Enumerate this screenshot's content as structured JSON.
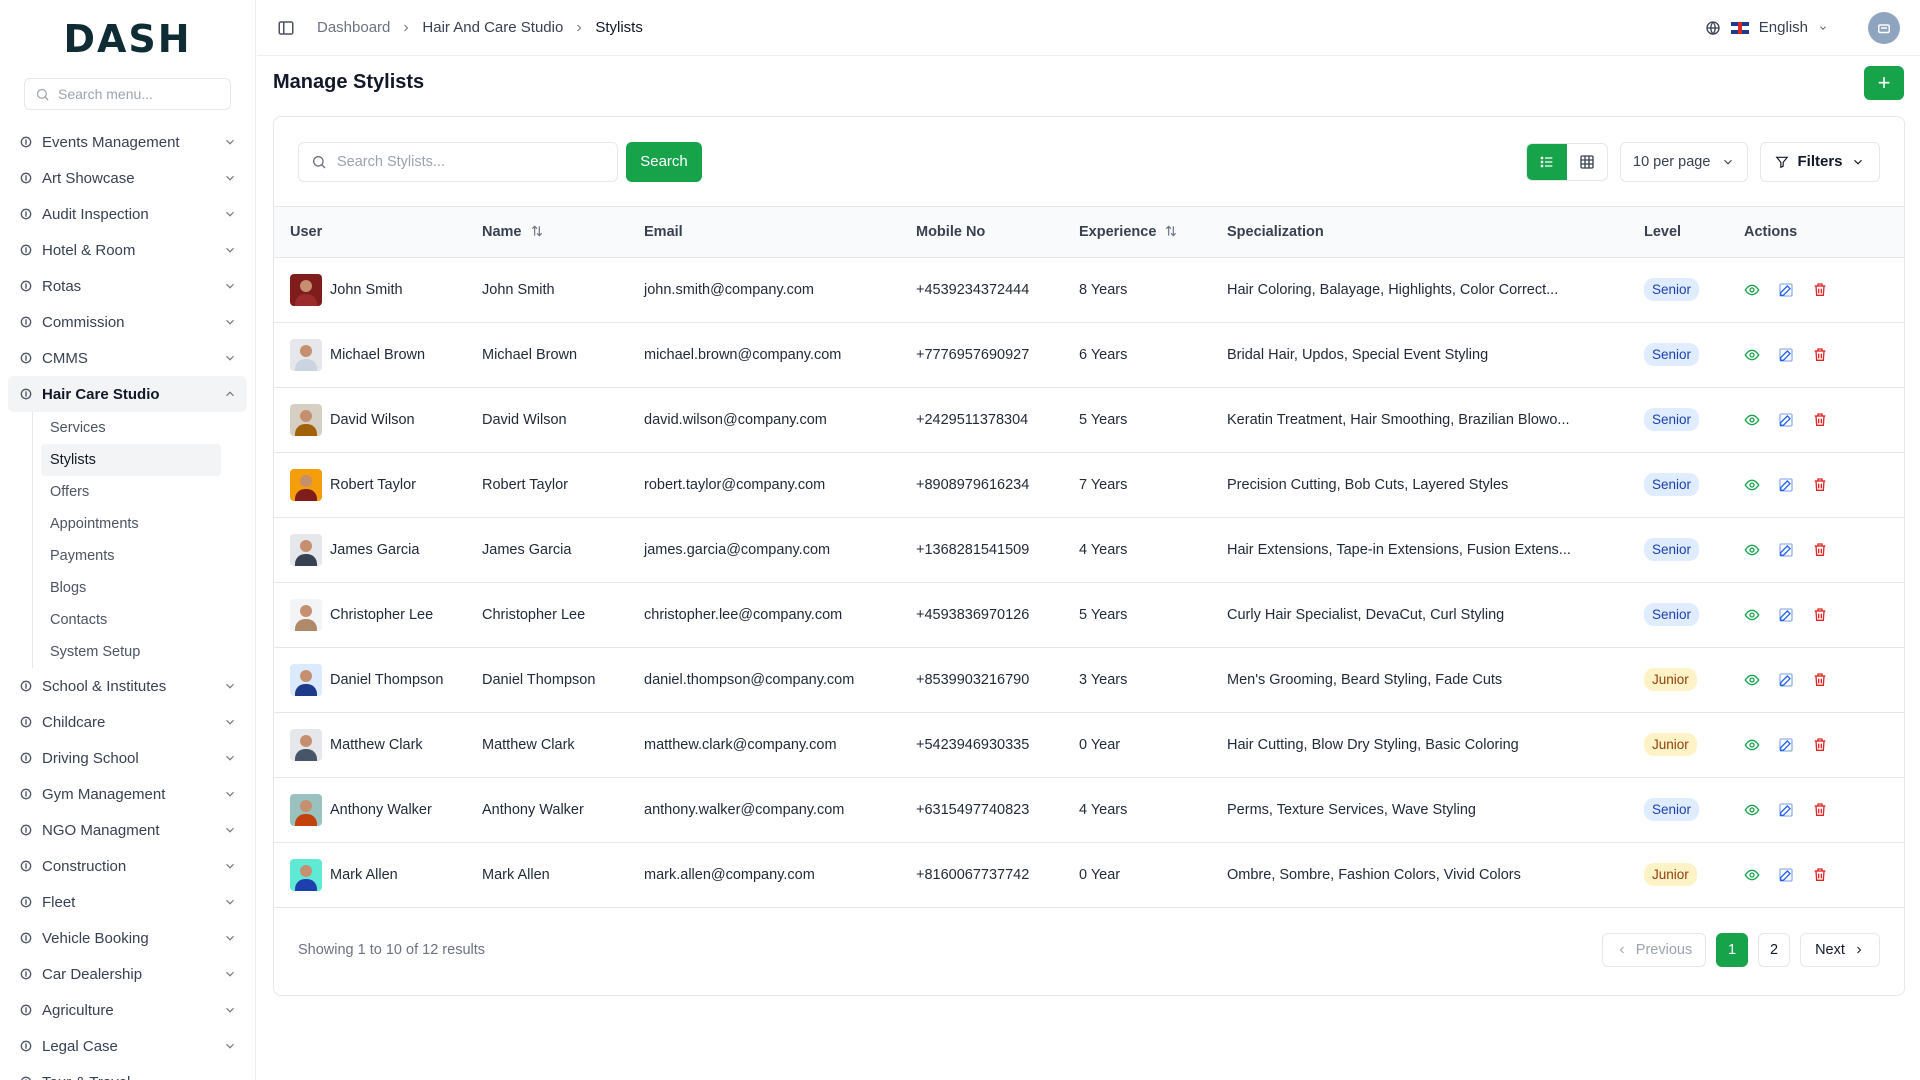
{
  "app": {
    "logo": "DASH"
  },
  "sidebar": {
    "search_placeholder": "Search menu...",
    "items": [
      {
        "label": "Events Management",
        "icon": "events-icon"
      },
      {
        "label": "Art Showcase",
        "icon": "palette-icon"
      },
      {
        "label": "Audit Inspection",
        "icon": "audit-icon"
      },
      {
        "label": "Hotel & Room",
        "icon": "hotel-icon"
      },
      {
        "label": "Rotas",
        "icon": "calendar-icon"
      },
      {
        "label": "Commission",
        "icon": "trend-icon"
      },
      {
        "label": "CMMS",
        "icon": "cog-icon"
      },
      {
        "label": "Hair Care Studio",
        "icon": "scissors-icon"
      }
    ],
    "sub_items": [
      "Services",
      "Stylists",
      "Offers",
      "Appointments",
      "Payments",
      "Blogs",
      "Contacts",
      "System Setup"
    ],
    "items_after": [
      {
        "label": "School & Institutes",
        "icon": "school-icon"
      },
      {
        "label": "Childcare",
        "icon": "childcare-icon"
      },
      {
        "label": "Driving School",
        "icon": "steering-icon"
      },
      {
        "label": "Gym Management",
        "icon": "dumbbell-icon"
      },
      {
        "label": "NGO Managment",
        "icon": "handshake-icon"
      },
      {
        "label": "Construction",
        "icon": "construction-icon"
      },
      {
        "label": "Fleet",
        "icon": "fleet-icon"
      },
      {
        "label": "Vehicle Booking",
        "icon": "car-icon"
      },
      {
        "label": "Car Dealership",
        "icon": "car-dealer-icon"
      },
      {
        "label": "Agriculture",
        "icon": "agriculture-icon"
      },
      {
        "label": "Legal Case",
        "icon": "scale-icon"
      },
      {
        "label": "Tour & Travel",
        "icon": "travel-icon"
      }
    ]
  },
  "header": {
    "breadcrumb": [
      "Dashboard",
      "Hair And Care Studio",
      "Stylists"
    ],
    "language": "English"
  },
  "page": {
    "title": "Manage Stylists",
    "add_label": "+"
  },
  "toolbar": {
    "search_placeholder": "Search Stylists...",
    "search_button": "Search",
    "per_page": "10 per page",
    "filters": "Filters"
  },
  "table": {
    "columns": [
      "User",
      "Name",
      "Email",
      "Mobile No",
      "Experience",
      "Specialization",
      "Level",
      "Actions"
    ],
    "rows": [
      {
        "user": "John Smith",
        "name": "John Smith",
        "email": "john.smith@company.com",
        "mobile": "+4539234372444",
        "experience": "8 Years",
        "specialization": "Hair Coloring, Balayage, Highlights, Color Correct...",
        "level": "Senior",
        "avatar_bg": "#7f1d1d",
        "avatar_shirt": "#9b2c2c"
      },
      {
        "user": "Michael Brown",
        "name": "Michael Brown",
        "email": "michael.brown@company.com",
        "mobile": "+7776957690927",
        "experience": "6 Years",
        "specialization": "Bridal Hair, Updos, Special Event Styling",
        "level": "Senior",
        "avatar_bg": "#e5e7eb",
        "avatar_shirt": "#cbd5e1"
      },
      {
        "user": "David Wilson",
        "name": "David Wilson",
        "email": "david.wilson@company.com",
        "mobile": "+2429511378304",
        "experience": "5 Years",
        "specialization": "Keratin Treatment, Hair Smoothing, Brazilian Blowo...",
        "level": "Senior",
        "avatar_bg": "#d6cfc4",
        "avatar_shirt": "#a16207"
      },
      {
        "user": "Robert Taylor",
        "name": "Robert Taylor",
        "email": "robert.taylor@company.com",
        "mobile": "+8908979616234",
        "experience": "7 Years",
        "specialization": "Precision Cutting, Bob Cuts, Layered Styles",
        "level": "Senior",
        "avatar_bg": "#f59e0b",
        "avatar_shirt": "#7f1d1d"
      },
      {
        "user": "James Garcia",
        "name": "James Garcia",
        "email": "james.garcia@company.com",
        "mobile": "+1368281541509",
        "experience": "4 Years",
        "specialization": "Hair Extensions, Tape-in Extensions, Fusion Extens...",
        "level": "Senior",
        "avatar_bg": "#e5e7eb",
        "avatar_shirt": "#374151"
      },
      {
        "user": "Christopher Lee",
        "name": "Christopher Lee",
        "email": "christopher.lee@company.com",
        "mobile": "+4593836970126",
        "experience": "5 Years",
        "specialization": "Curly Hair Specialist, DevaCut, Curl Styling",
        "level": "Senior",
        "avatar_bg": "#f3f4f6",
        "avatar_shirt": "#b08968"
      },
      {
        "user": "Daniel Thompson",
        "name": "Daniel Thompson",
        "email": "daniel.thompson@company.com",
        "mobile": "+8539903216790",
        "experience": "3 Years",
        "specialization": "Men's Grooming, Beard Styling, Fade Cuts",
        "level": "Junior",
        "avatar_bg": "#dbeafe",
        "avatar_shirt": "#1e3a8a"
      },
      {
        "user": "Matthew Clark",
        "name": "Matthew Clark",
        "email": "matthew.clark@company.com",
        "mobile": "+5423946930335",
        "experience": "0 Year",
        "specialization": "Hair Cutting, Blow Dry Styling, Basic Coloring",
        "level": "Junior",
        "avatar_bg": "#e5e7eb",
        "avatar_shirt": "#475569"
      },
      {
        "user": "Anthony Walker",
        "name": "Anthony Walker",
        "email": "anthony.walker@company.com",
        "mobile": "+6315497740823",
        "experience": "4 Years",
        "specialization": "Perms, Texture Services, Wave Styling",
        "level": "Senior",
        "avatar_bg": "#99c2bf",
        "avatar_shirt": "#c2410c"
      },
      {
        "user": "Mark Allen",
        "name": "Mark Allen",
        "email": "mark.allen@company.com",
        "mobile": "+8160067737742",
        "experience": "0 Year",
        "specialization": "Ombre, Sombre, Fashion Colors, Vivid Colors",
        "level": "Junior",
        "avatar_bg": "#5eead4",
        "avatar_shirt": "#1e40af"
      }
    ]
  },
  "footer": {
    "showing": "Showing 1 to 10 of 12 results",
    "previous": "Previous",
    "pages": [
      "1",
      "2"
    ],
    "next": "Next"
  },
  "colors": {
    "accent": "#16a34a",
    "senior_badge": "#e0ecff",
    "junior_badge": "#fef3c7"
  }
}
